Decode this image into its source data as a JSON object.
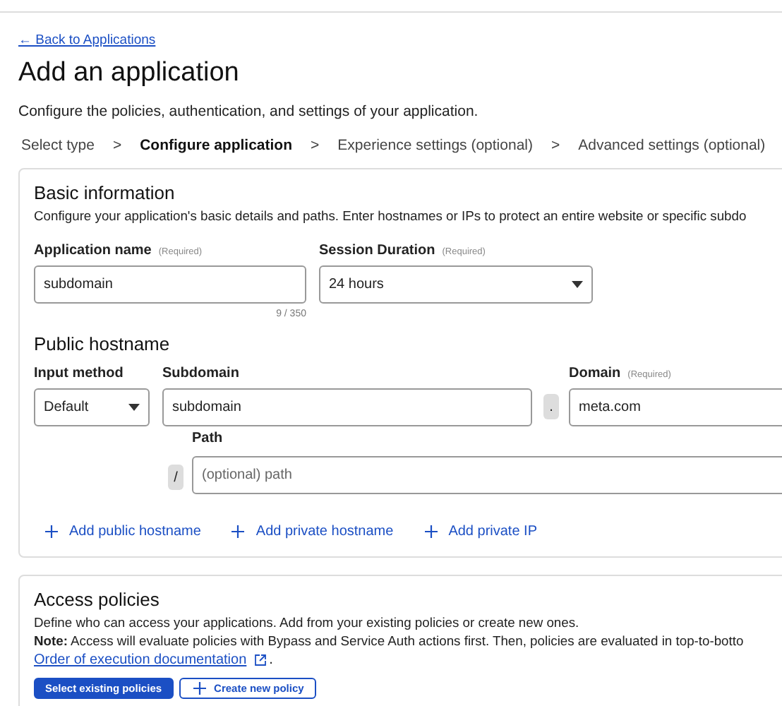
{
  "back_link": "← Back to Applications",
  "title": "Add an application",
  "subtitle": "Configure the policies, authentication, and settings of your application.",
  "steps": [
    {
      "label": "Select type",
      "selected": false
    },
    {
      "label": "Configure application",
      "selected": true
    },
    {
      "label": "Experience settings (optional)",
      "selected": false
    },
    {
      "label": "Advanced settings (optional)",
      "selected": false
    }
  ],
  "step_separator": ">",
  "basic_information": {
    "title": "Basic information",
    "description": "Configure your application's basic details and paths. Enter hostnames or IPs to protect an entire website or specific subdo",
    "application_name": {
      "label": "Application name",
      "required": "(Required)",
      "value": "subdomain",
      "counter": "9 / 350"
    },
    "session_duration": {
      "label": "Session Duration",
      "required": "(Required)",
      "value": "24 hours"
    }
  },
  "public_hostname": {
    "title": "Public hostname",
    "input_method": {
      "label": "Input method",
      "value": "Default"
    },
    "subdomain": {
      "label": "Subdomain",
      "value": "subdomain"
    },
    "dot": ".",
    "domain": {
      "label": "Domain",
      "required": "(Required)",
      "value": "meta.com"
    },
    "path": {
      "label": "Path",
      "prefix": "/",
      "placeholder": "(optional) path"
    }
  },
  "add_links": [
    "Add public hostname",
    "Add private hostname",
    "Add private IP"
  ],
  "access_policies": {
    "title": "Access policies",
    "description": "Define who can access your applications. Add from your existing policies or create new ones.",
    "note": "**Note:** Access will evaluate policies with Bypass and Service Auth actions first. Then, policies are evaluated in top-to-botto",
    "doc_link": "Order of execution documentation",
    "doc_link_end": ".",
    "buttons": [
      {
        "label": "Select existing policies",
        "kind": "primary"
      },
      {
        "label": "Create new policy",
        "kind": "secondary"
      }
    ]
  }
}
